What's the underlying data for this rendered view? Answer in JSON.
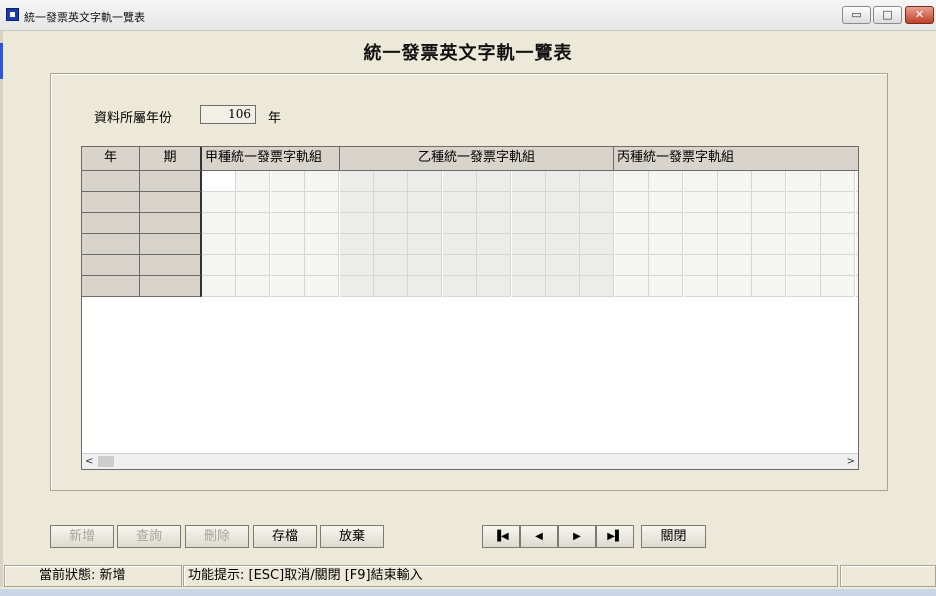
{
  "window": {
    "title": "統一發票英文字軌一覽表",
    "minimize_glyph": "▭",
    "maximize_glyph": "□",
    "close_glyph": "✕"
  },
  "heading": "統一發票英文字軌一覽表",
  "year_field": {
    "label": "資料所屬年份",
    "value": "106",
    "unit": "年"
  },
  "grid": {
    "headers": {
      "year": "年",
      "period": "期",
      "group_a": "甲種統一發票字軌組",
      "group_b": "乙種統一發票字軌組",
      "group_c": "丙種統一發票字軌組"
    },
    "row_count": 6,
    "scroll_left": "<",
    "scroll_right": ">"
  },
  "buttons": {
    "add": "新增",
    "query": "查詢",
    "delete": "刪除",
    "save": "存檔",
    "discard": "放棄",
    "first": "▐◀",
    "prev": "◀",
    "next": "▶",
    "last": "▶▌",
    "close": "關閉"
  },
  "status": {
    "state": "當前狀態: 新增",
    "hint": "功能提示: [ESC]取消/關閉 [F9]結束輸入"
  },
  "colors": {
    "background": "#ece9d8",
    "header_cell": "#d8d4cb",
    "disabled_text": "#a7a59b"
  }
}
